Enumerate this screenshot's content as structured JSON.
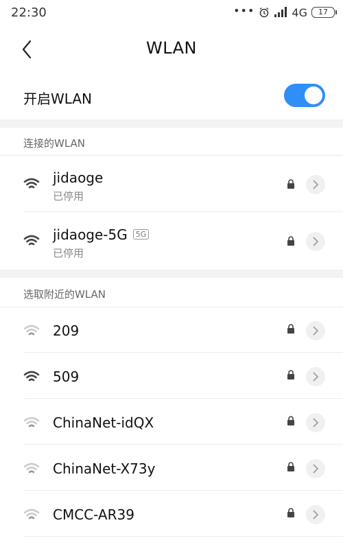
{
  "status_bar": {
    "time": "22:30",
    "dots": "•••",
    "network": "4G",
    "battery": "17"
  },
  "header": {
    "title": "WLAN",
    "back_icon": "back-arrow"
  },
  "toggle": {
    "label": "开启WLAN",
    "state": "on",
    "accent": "#2f8ef8"
  },
  "connected": {
    "title": "连接的WLAN",
    "items": [
      {
        "name": "jidaoge",
        "status": "已停用",
        "badge": "",
        "signal": "strong",
        "secured": true
      },
      {
        "name": "jidaoge-5G",
        "status": "已停用",
        "badge": "5G",
        "signal": "strong",
        "secured": true
      }
    ]
  },
  "nearby": {
    "title": "选取附近的WLAN",
    "items": [
      {
        "name": "209",
        "signal": "weak",
        "secured": true
      },
      {
        "name": "509",
        "signal": "strong",
        "secured": true
      },
      {
        "name": "ChinaNet-idQX",
        "signal": "weak",
        "secured": true
      },
      {
        "name": "ChinaNet-X73y",
        "signal": "weak",
        "secured": true
      },
      {
        "name": "CMCC-AR39",
        "signal": "weak",
        "secured": true
      }
    ]
  }
}
